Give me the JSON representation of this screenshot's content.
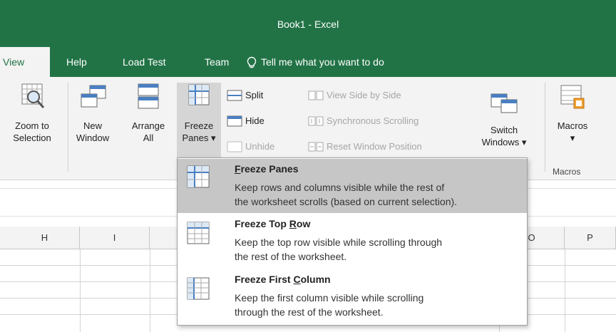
{
  "window": {
    "title": "Book1  -  Excel"
  },
  "tabs": {
    "view": "View",
    "help": "Help",
    "load_test": "Load Test",
    "team": "Team",
    "tell_me": "Tell me what you want to do"
  },
  "ribbon": {
    "zoom_to_selection": [
      "Zoom to",
      "Selection"
    ],
    "new_window": [
      "New",
      "Window"
    ],
    "arrange_all": [
      "Arrange",
      "All"
    ],
    "freeze_panes": [
      "Freeze",
      "Panes ▾"
    ],
    "split": "Split",
    "hide": "Hide",
    "unhide": "Unhide",
    "view_side_by_side": "View Side by Side",
    "synchronous_scrolling": "Synchronous Scrolling",
    "reset_window_position": "Reset Window Position",
    "switch_windows": [
      "Switch",
      "Windows ▾"
    ],
    "macros": [
      "Macros",
      "▾"
    ],
    "macros_group": "Macros"
  },
  "columns": [
    "H",
    "I",
    "",
    "",
    "",
    "",
    "",
    "O",
    "P"
  ],
  "freeze_menu": [
    {
      "title_pre": "",
      "title_ul": "F",
      "title_post": "reeze Panes",
      "desc": [
        "Keep rows and columns visible while the rest of",
        "the worksheet scrolls (based on current selection)."
      ]
    },
    {
      "title_pre": "Freeze Top ",
      "title_ul": "R",
      "title_post": "ow",
      "desc": [
        "Keep the top row visible while scrolling through",
        "the rest of the worksheet."
      ]
    },
    {
      "title_pre": "Freeze First ",
      "title_ul": "C",
      "title_post": "olumn",
      "desc": [
        "Keep the first column visible while scrolling",
        "through the rest of the worksheet."
      ]
    }
  ],
  "colors": {
    "excel_green": "#217346",
    "ribbon_bg": "#f3f3f3",
    "hover_gray": "#c6c6c6"
  }
}
